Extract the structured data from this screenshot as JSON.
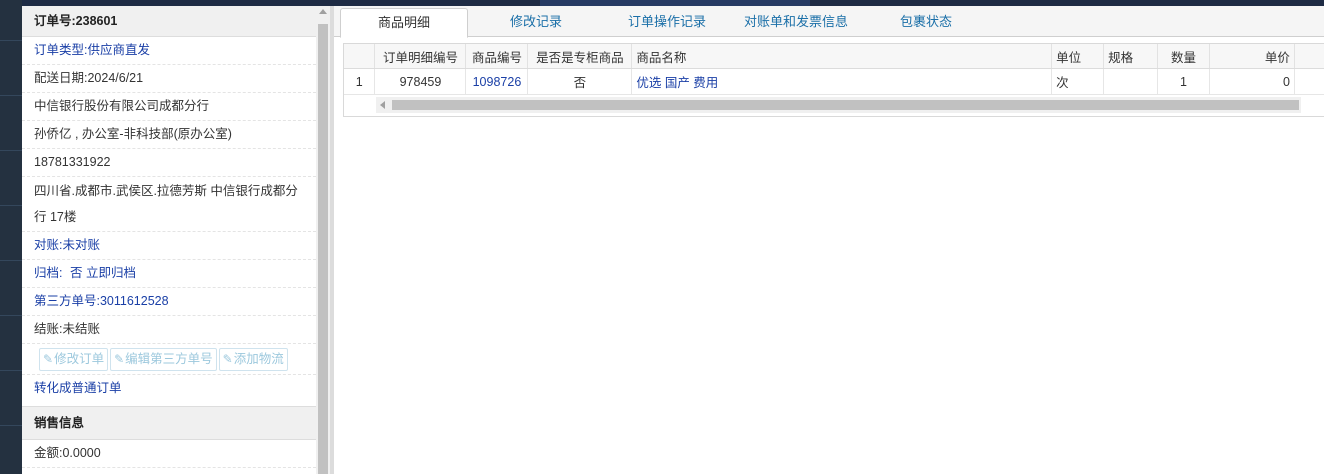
{
  "order": {
    "number_label": "订单号:238601",
    "type_label": "订单类型:",
    "type_value": "供应商直发",
    "delivery_date": "配送日期:2024/6/21",
    "company": "中信银行股份有限公司成都分行",
    "contact": "孙侨亿 , 办公室-非科技部(原办公室)",
    "phone": "18781331922",
    "address": "四川省.成都市.武侯区.拉德芳斯 中信银行成都分行 17楼",
    "reconcile": "对账:未对账",
    "archive_label": "归档:",
    "archive_value": "否",
    "archive_link": "立即归档",
    "third_party": "第三方单号:3011612528",
    "settle": "结账:未结账"
  },
  "actions": {
    "edit_order": "修改订单",
    "edit_third_party": "编辑第三方单号",
    "add_logistics": "添加物流",
    "convert": "转化成普通订单"
  },
  "sales": {
    "title": "销售信息",
    "amount": "金额:0.0000"
  },
  "tabs": [
    {
      "label": "商品明细"
    },
    {
      "label": "修改记录"
    },
    {
      "label": "订单操作记录"
    },
    {
      "label": "对账单和发票信息"
    },
    {
      "label": "包裹状态"
    }
  ],
  "grid": {
    "headers": [
      "订单明细编号",
      "商品编号",
      "是否是专柜商品",
      "商品名称",
      "单位",
      "规格",
      "数量",
      "单价"
    ],
    "rows": [
      {
        "index": "1",
        "detail_no": "978459",
        "product_no": "1098726",
        "is_counter": "否",
        "name": "优选 国产 费用",
        "unit": "次",
        "spec": "",
        "qty": "1",
        "price": "0"
      }
    ]
  },
  "colors": {
    "accent_blue": "#1a3fa6",
    "tab_blue": "#1a6fa8",
    "disabled_button": "#9cc8dd"
  }
}
